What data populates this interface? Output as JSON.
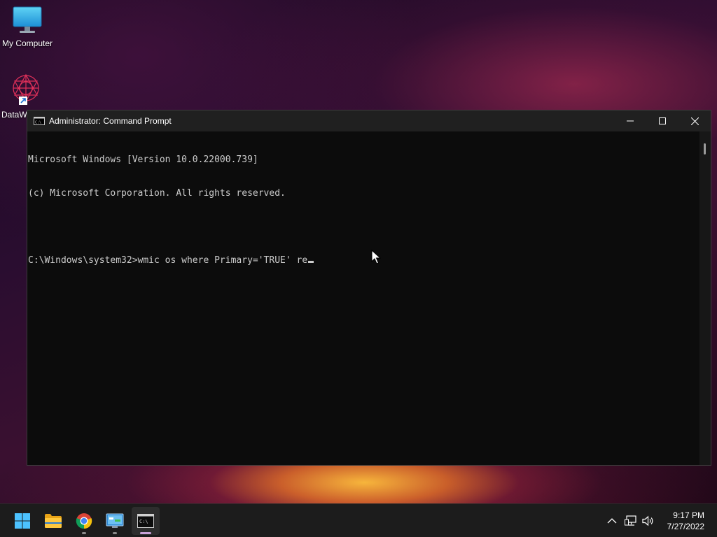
{
  "desktop": {
    "icons": [
      {
        "label": "My Computer",
        "icon": "monitor-icon"
      },
      {
        "label": "DataW",
        "icon": "datawatch-app-icon"
      }
    ]
  },
  "window": {
    "title": "Administrator: Command Prompt",
    "console_lines": [
      "Microsoft Windows [Version 10.0.22000.739]",
      "(c) Microsoft Corporation. All rights reserved.",
      "",
      "C:\\Windows\\system32>wmic os where Primary='TRUE' re"
    ],
    "colors": {
      "background": "#0c0c0c",
      "text": "#cccccc",
      "titlebar": "#202020"
    }
  },
  "taskbar": {
    "apps": [
      {
        "name": "start",
        "icon": "windows-start-icon"
      },
      {
        "name": "file-explorer",
        "icon": "folder-icon"
      },
      {
        "name": "chrome",
        "icon": "chrome-icon"
      },
      {
        "name": "control-panel",
        "icon": "control-panel-icon"
      },
      {
        "name": "command-prompt",
        "icon": "terminal-icon",
        "active": true
      }
    ],
    "tray": {
      "icons": [
        "chevron-up-icon",
        "network-icon",
        "volume-icon"
      ],
      "time": "9:17 PM",
      "date": "7/27/2022"
    }
  }
}
